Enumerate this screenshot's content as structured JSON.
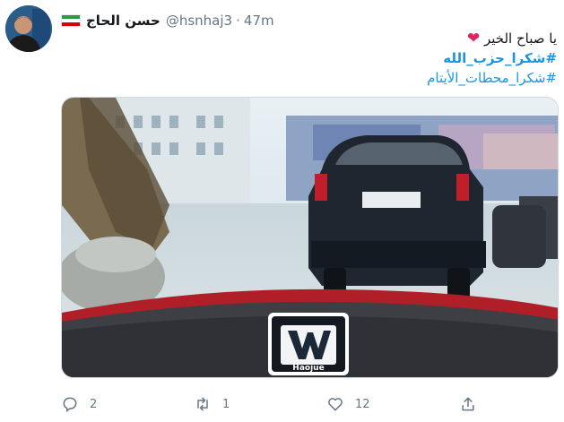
{
  "user": {
    "display_name": "حسن الحاج",
    "handle": "@hsnhaj3",
    "separator": "·",
    "time": "47m"
  },
  "tweet": {
    "line1": "يا صباح الخير",
    "hashtag1": "#شكرا_حزب_الله",
    "hashtag2": "#شكرا_محطات_الأيتام"
  },
  "media": {
    "badge_brand": "Haojue"
  },
  "actions": {
    "reply_count": "2",
    "retweet_count": "1",
    "like_count": "12"
  },
  "colors": {
    "accent": "#1b95e0",
    "heart": "#e0245e",
    "muted": "#657786"
  }
}
